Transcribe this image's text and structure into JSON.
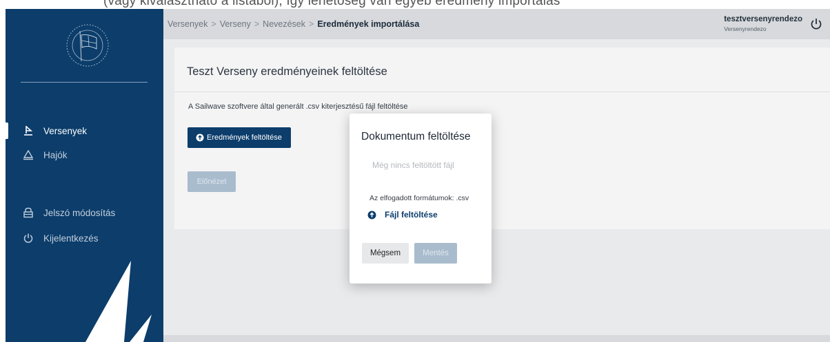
{
  "top_strip_text": "(vagy kiválasztható a listából), így lehetőség van egyéb eredmény importálás",
  "sidebar": {
    "items": [
      {
        "label": "Versenyek",
        "icon": "sailboat-icon",
        "active": true
      },
      {
        "label": "Hajók",
        "icon": "boat-hull-icon",
        "active": false
      },
      {
        "label": "Jelszó módosítás",
        "icon": "lock-icon",
        "active": false
      },
      {
        "label": "Kijelentkezés",
        "icon": "power-icon",
        "active": false
      }
    ]
  },
  "breadcrumb": {
    "items": [
      "Versenyek",
      "Verseny",
      "Nevezések"
    ],
    "separator": ">",
    "current": "Eredmények importálása"
  },
  "user": {
    "name": "tesztversenyrendezo",
    "role": "Versenyrendezo"
  },
  "card": {
    "title": "Teszt Verseny eredményeinek feltöltése",
    "description": "A Sailwave szoftvere által generált .csv kiterjesztésű fájl feltöltése",
    "upload_label": "Eredmények feltöltése",
    "preview_label": "Előnézet"
  },
  "modal": {
    "title": "Dokumentum feltöltése",
    "empty_text": "Még nincs feltöltött fájl",
    "formats_text": "Az elfogadott formátumok: .csv",
    "file_upload_label": "Fájl feltöltése",
    "cancel_label": "Mégsem",
    "save_label": "Mentés"
  },
  "colors": {
    "brand": "#0c3d6b",
    "disabled": "#a9bccd",
    "background": "#e9eaec"
  }
}
